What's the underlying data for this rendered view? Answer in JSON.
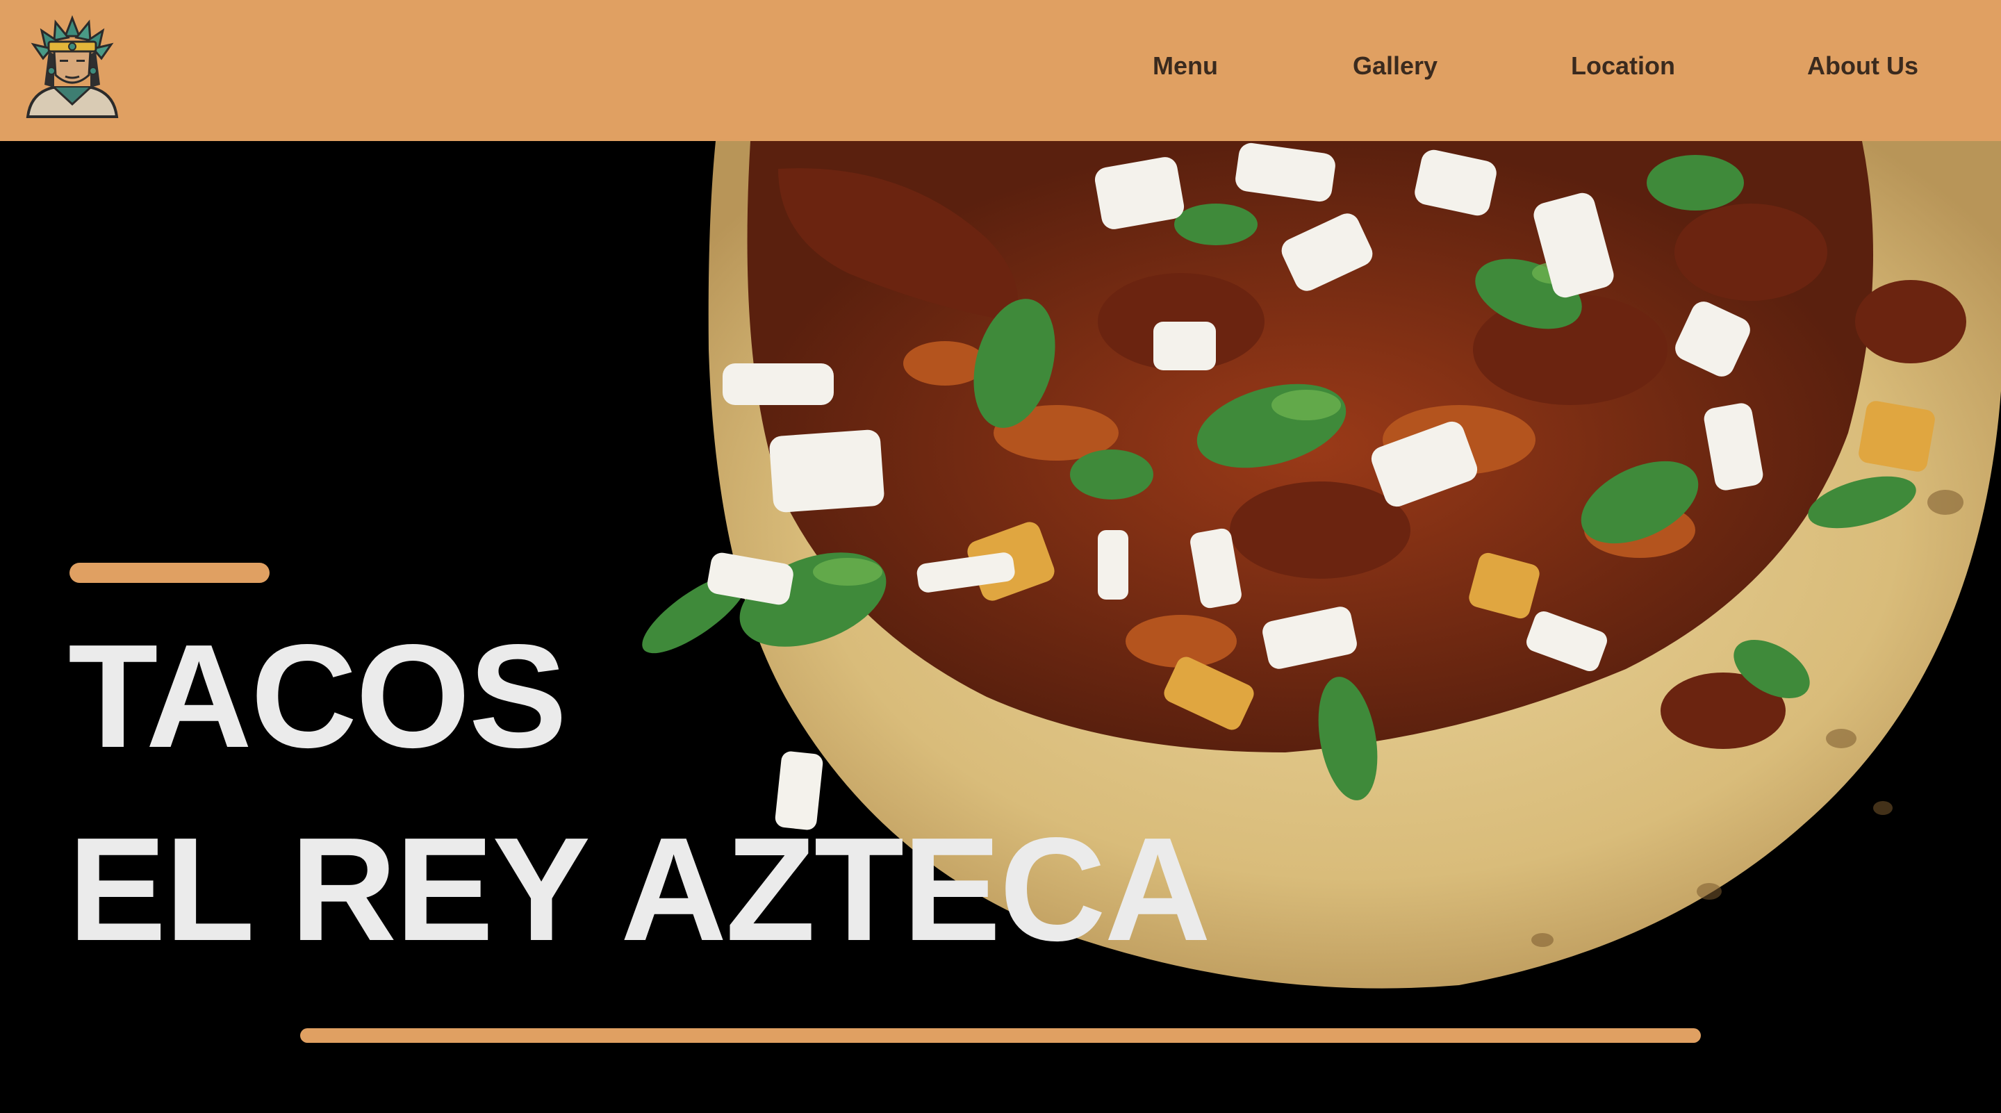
{
  "nav": {
    "logo_icon": "aztec-king-mascot-icon",
    "links": [
      "Menu",
      "Gallery",
      "Location",
      "About Us"
    ]
  },
  "hero": {
    "title_line1": "TACOS",
    "title_line2": "EL REY AZTECA",
    "image_subject": "taco-photo"
  },
  "colors": {
    "accent": "#E0A062",
    "background": "#000000",
    "title_text": "#EBEBEB",
    "nav_text": "#3A2A1E"
  }
}
